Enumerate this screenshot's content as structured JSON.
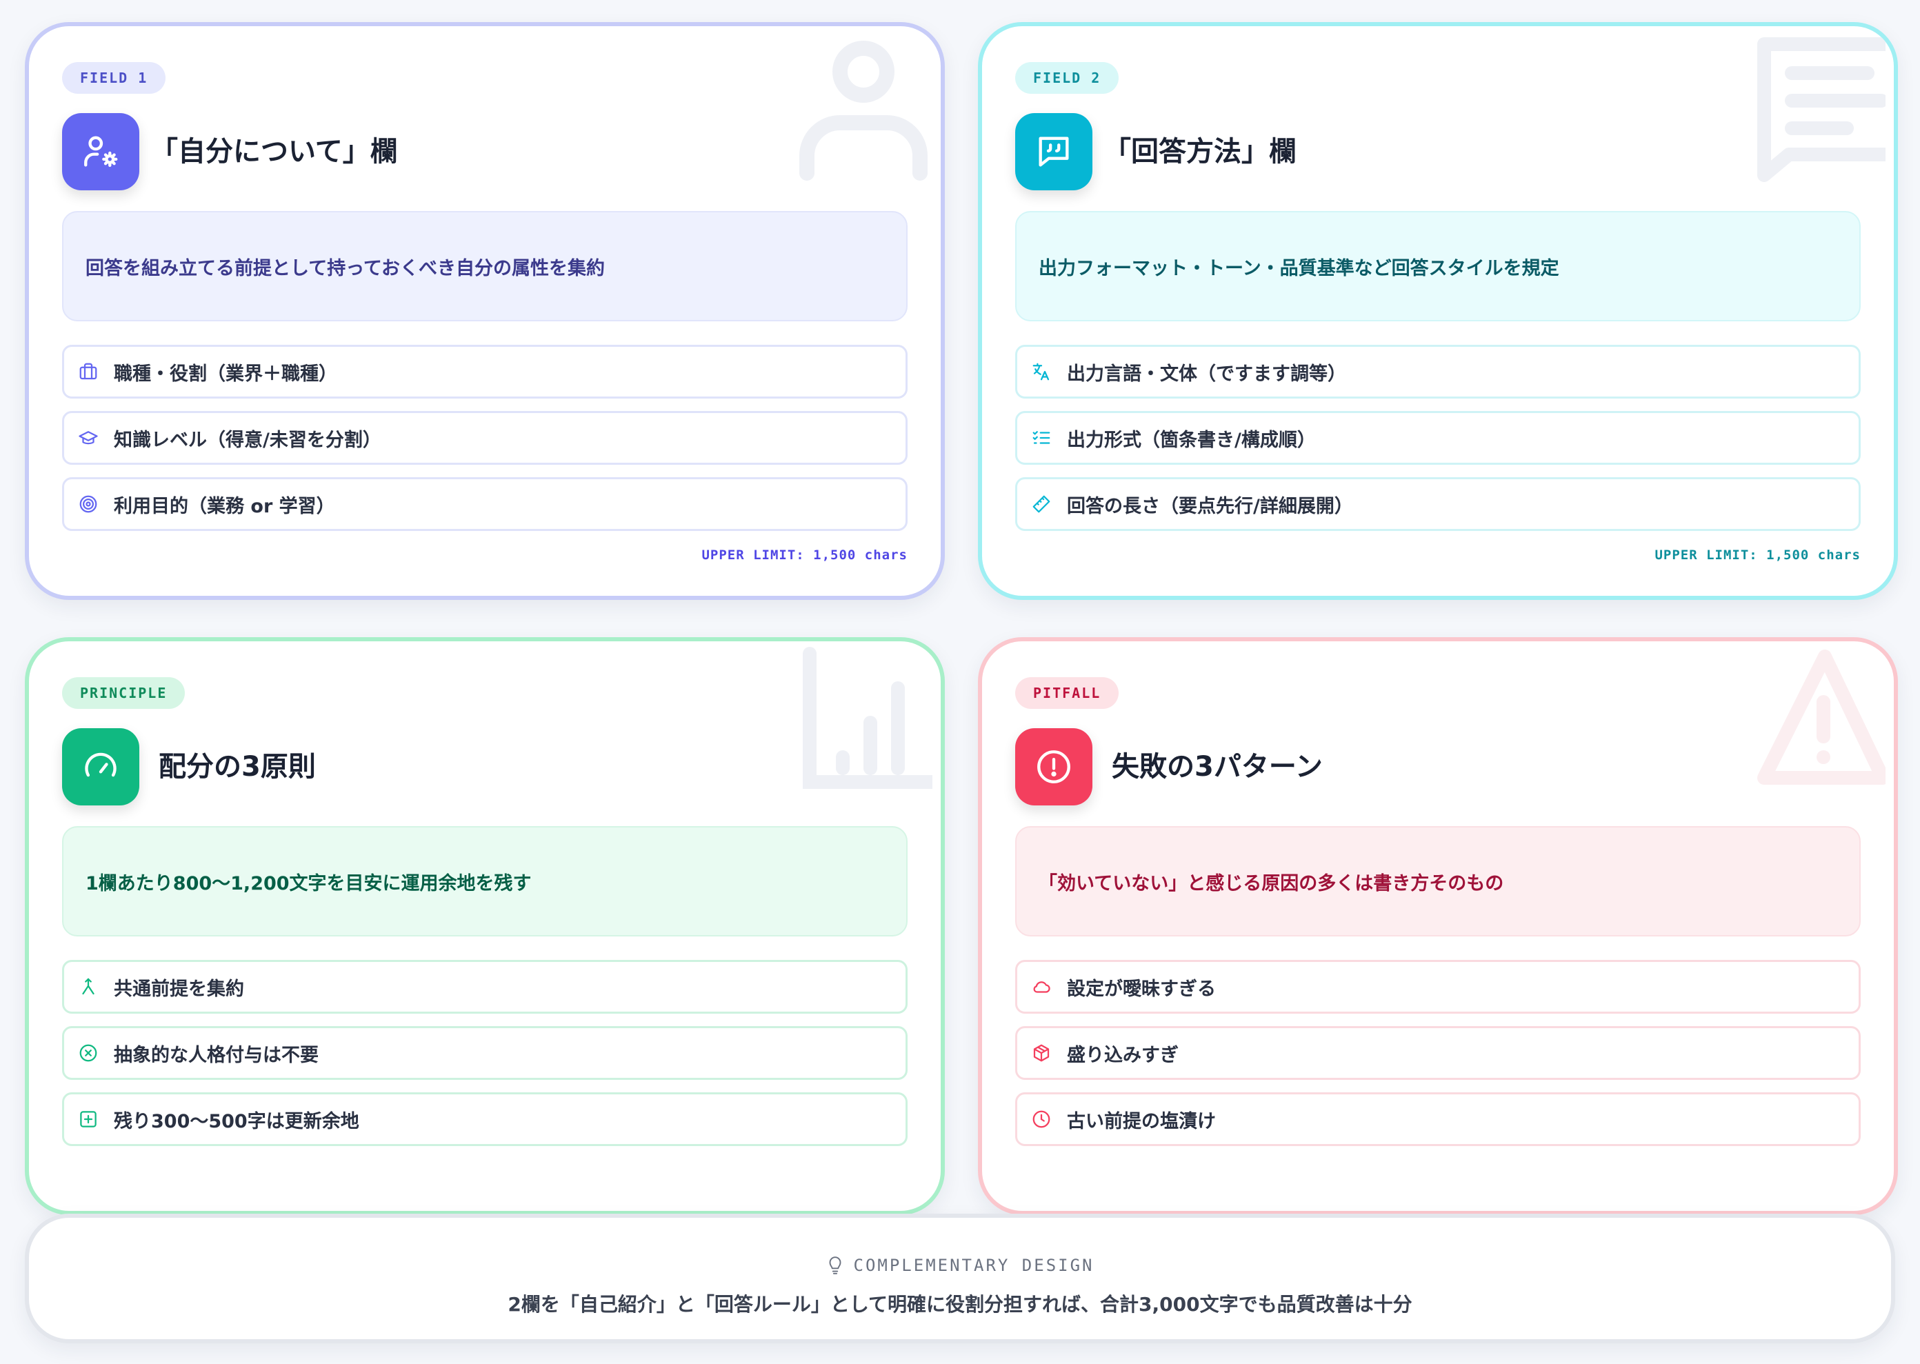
{
  "colors": {
    "indigo": "#6366f1",
    "cyan": "#06b6d4",
    "green": "#10b981",
    "red": "#f43f5e"
  },
  "cards": [
    {
      "tag": "FIELD 1",
      "icon": "user-gear-icon",
      "title": "「自分について」欄",
      "description": "回答を組み立てる前提として持っておくべき自分の属性を集約",
      "items": [
        {
          "icon": "briefcase-icon",
          "label": "職種・役割（業界＋職種）"
        },
        {
          "icon": "graduation-cap-icon",
          "label": "知識レベル（得意/未習を分割）"
        },
        {
          "icon": "target-icon",
          "label": "利用目的（業務 or 学習）"
        }
      ],
      "limit": "UPPER LIMIT: 1,500 chars"
    },
    {
      "tag": "FIELD 2",
      "icon": "quote-bubble-icon",
      "title": "「回答方法」欄",
      "description": "出力フォーマット・トーン・品質基準など回答スタイルを規定",
      "items": [
        {
          "icon": "translate-icon",
          "label": "出力言語・文体（ですます調等）"
        },
        {
          "icon": "list-check-icon",
          "label": "出力形式（箇条書き/構成順）"
        },
        {
          "icon": "ruler-icon",
          "label": "回答の長さ（要点先行/詳細展開）"
        }
      ],
      "limit": "UPPER LIMIT: 1,500 chars"
    },
    {
      "tag": "PRINCIPLE",
      "icon": "gauge-icon",
      "title": "配分の3原則",
      "description": "1欄あたり800〜1,200文字を目安に運用余地を残す",
      "items": [
        {
          "icon": "merge-icon",
          "label": "共通前提を集約"
        },
        {
          "icon": "circle-x-icon",
          "label": "抽象的な人格付与は不要"
        },
        {
          "icon": "square-plus-icon",
          "label": "残り300〜500字は更新余地"
        }
      ]
    },
    {
      "tag": "PITFALL",
      "icon": "alert-circle-icon",
      "title": "失敗の3パターン",
      "description": "「効いていない」と感じる原因の多くは書き方そのもの",
      "items": [
        {
          "icon": "cloud-icon",
          "label": "設定が曖昧すぎる"
        },
        {
          "icon": "package-icon",
          "label": "盛り込みすぎ"
        },
        {
          "icon": "clock-icon",
          "label": "古い前提の塩漬け"
        }
      ]
    }
  ],
  "footer": {
    "icon": "lightbulb-icon",
    "label": "COMPLEMENTARY DESIGN",
    "text": "2欄を「自己紹介」と「回答ルール」として明確に役割分担すれば、合計3,000文字でも品質改善は十分"
  }
}
